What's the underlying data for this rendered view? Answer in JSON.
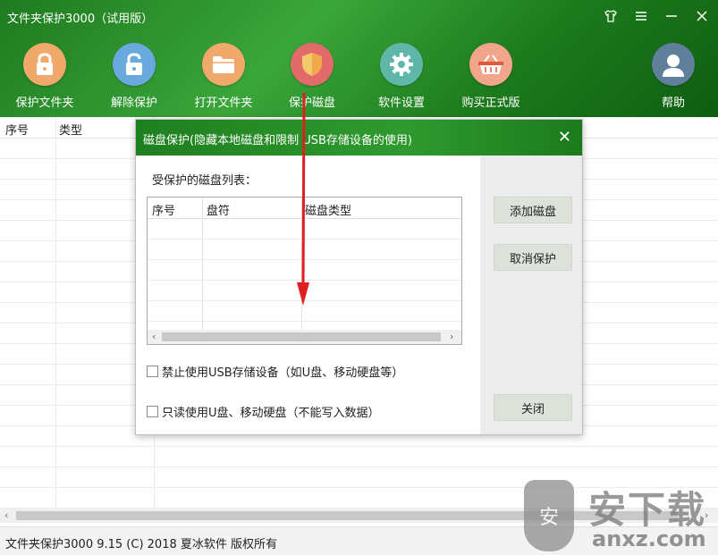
{
  "app": {
    "title": "文件夹保护3000（试用版）",
    "controls": [
      "shirt-icon",
      "menu-icon",
      "minimize-icon",
      "close-icon"
    ]
  },
  "toolbar": {
    "items": [
      {
        "label": "保护文件夹",
        "icon": "lock-closed-icon",
        "color": "#f0a96a"
      },
      {
        "label": "解除保护",
        "icon": "lock-open-icon",
        "color": "#6aa9dd"
      },
      {
        "label": "打开文件夹",
        "icon": "folder-icon",
        "color": "#f0a96a"
      },
      {
        "label": "保护磁盘",
        "icon": "shield-icon",
        "color": "#e36a6a"
      },
      {
        "label": "软件设置",
        "icon": "gear-icon",
        "color": "#5fb7a9"
      },
      {
        "label": "购买正式版",
        "icon": "basket-icon",
        "color": "#f1a58a"
      },
      {
        "label": "帮助",
        "icon": "user-icon",
        "color": "#5f7f9a"
      }
    ]
  },
  "main_table": {
    "columns": [
      "序号",
      "类型"
    ]
  },
  "status": {
    "text": "文件夹保护3000 9.15 (C) 2018 夏冰软件 版权所有"
  },
  "watermark": {
    "big": "安下载",
    "small": "anxz.com",
    "shield": "安"
  },
  "dialog": {
    "title": "磁盘保护(隐藏本地磁盘和限制 USB存储设备的使用)",
    "list_label": "受保护的磁盘列表：",
    "columns": [
      "序号",
      "盘符",
      "磁盘类型"
    ],
    "checkbox_usb": "禁止使用USB存储设备（如U盘、移动硬盘等）",
    "checkbox_readonly": "只读使用U盘、移动硬盘（不能写入数据）",
    "btn_add": "添加磁盘",
    "btn_cancel": "取消保护",
    "btn_close": "关闭",
    "close_glyph": "✕"
  },
  "colors": {
    "header_green": "#2f9a2f",
    "arrow_red": "#e02020"
  }
}
